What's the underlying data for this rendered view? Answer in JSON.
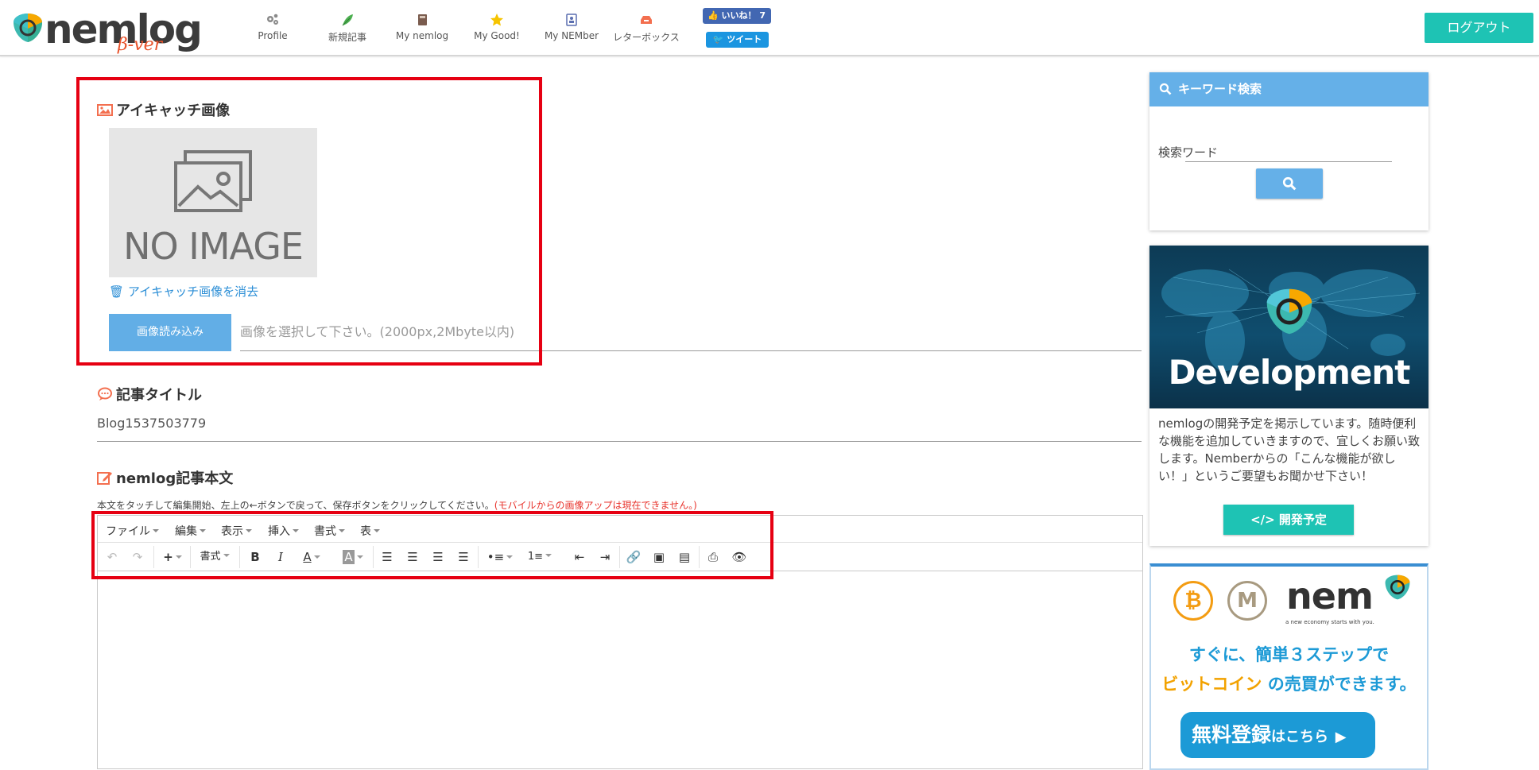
{
  "header": {
    "logo_text": "nemlog",
    "logo_beta": "β-ver",
    "nav": [
      {
        "label": "Profile",
        "icon": "gears-icon"
      },
      {
        "label": "新規記事",
        "icon": "feather-icon"
      },
      {
        "label": "My nemlog",
        "icon": "book-icon"
      },
      {
        "label": "My Good!",
        "icon": "star-icon"
      },
      {
        "label": "My NEMber",
        "icon": "contact-card-icon"
      },
      {
        "label": "レターボックス",
        "icon": "inbox-icon"
      }
    ],
    "fb_like": "いいね！ 7",
    "tweet": "ツイート",
    "logout": "ログアウト"
  },
  "eyecatch": {
    "heading": "アイキャッチ画像",
    "placeholder_text": "NO IMAGE",
    "delete_link": "アイキャッチ画像を消去",
    "upload_button": "画像読み込み",
    "file_placeholder": "画像を選択して下さい。(2000px,2Mbyte以内)"
  },
  "article_title": {
    "heading": "記事タイトル",
    "value": "Blog1537503779"
  },
  "body": {
    "heading": "nemlog記事本文",
    "help": "本文をタッチして編集開始、左上の←ボタンで戻って、保存ボタンをクリックしてください。",
    "warning": "(モバイルからの画像アップは現在できません。)",
    "menu": [
      "ファイル",
      "編集",
      "表示",
      "挿入",
      "書式",
      "表"
    ],
    "format_dropdown": "書式"
  },
  "sidebar": {
    "search": {
      "heading": "キーワード検索",
      "label": "検索ワード"
    },
    "dev": {
      "banner_title": "Development",
      "description": "nemlogの開発予定を掲示しています。随時便利な機能を追加していきますので、宜しくお願い致します。Nemberからの「こんな機能が欲しい！」というご要望もお聞かせ下さい！",
      "button": "開発予定"
    },
    "nem_ad": {
      "logo": "nem",
      "tagline": "a new economy starts with you.",
      "line1": "すぐに、簡単３ステップで",
      "line2_highlight": "ビットコイン",
      "line2_rest": " の売買ができます。",
      "cta_main": "無料登録",
      "cta_small": "はこちら"
    }
  },
  "colors": {
    "accent_teal": "#1ec3b4",
    "accent_blue": "#65b0e8",
    "annotation_red": "#e60012",
    "link_blue": "#2b8ed6"
  }
}
